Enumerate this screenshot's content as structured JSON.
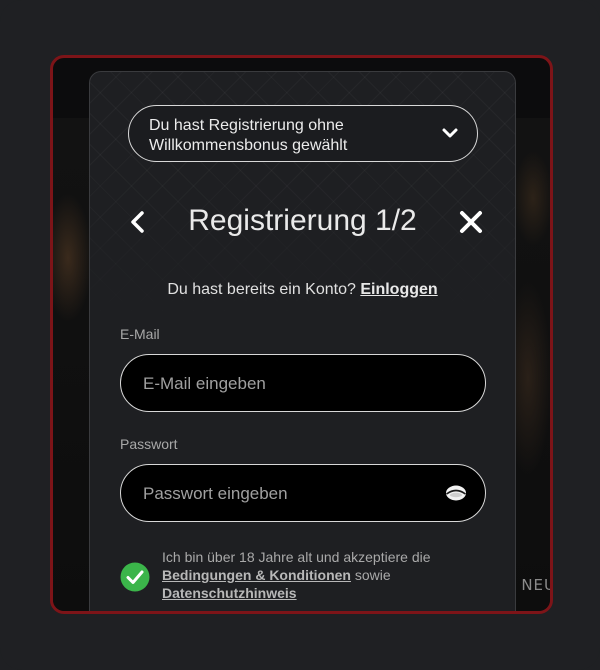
{
  "bonus_selector": {
    "text": "Du hast Registrierung ohne Willkommensbonus gewählt",
    "icon": "chevron-down-icon"
  },
  "header": {
    "title": "Registrierung 1/2",
    "back_icon": "chevron-left-icon",
    "close_icon": "close-icon"
  },
  "login_prompt": {
    "text": "Du hast bereits ein Konto?",
    "link": "Einloggen"
  },
  "email": {
    "label": "E-Mail",
    "placeholder": "E-Mail eingeben",
    "value": ""
  },
  "password": {
    "label": "Passwort",
    "placeholder": "Passwort eingeben",
    "value": "",
    "toggle_icon": "eye-icon"
  },
  "consent": {
    "checked": true,
    "text_before": "Ich bin über 18 Jahre alt und akzeptiere die",
    "terms_link": "Bedingungen & Konditionen",
    "text_middle": "sowie",
    "privacy_link": "Datenschutzhinweis",
    "check_color": "#3bb54a"
  },
  "background": {
    "partial_text": "NEU"
  },
  "colors": {
    "frame_border": "#7d1418",
    "modal_bg": "#1e1f22"
  }
}
